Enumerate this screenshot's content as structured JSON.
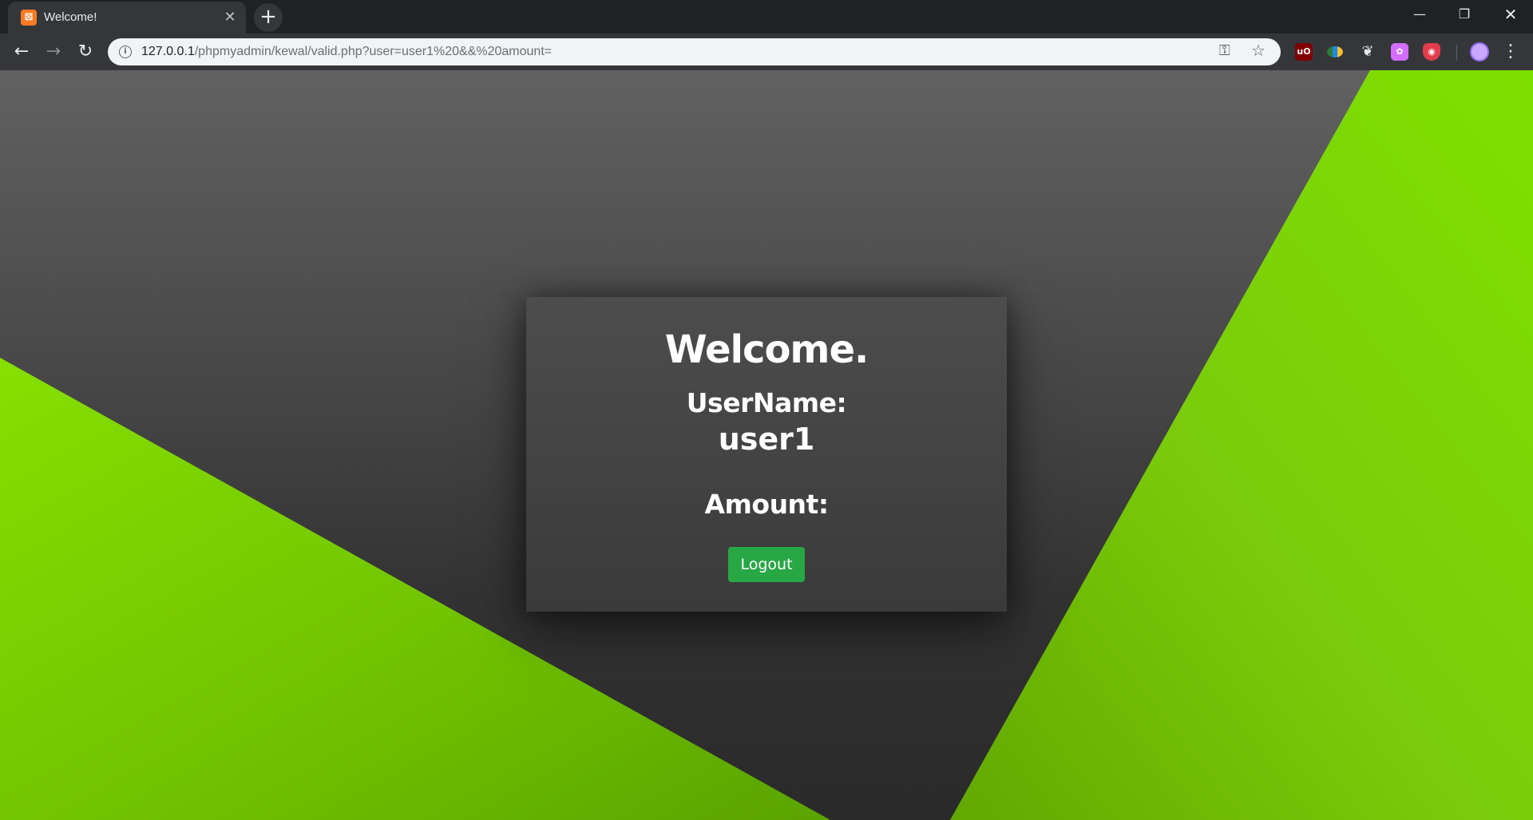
{
  "browser": {
    "tab": {
      "title": "Welcome!",
      "favicon_icon": "xampp-icon",
      "close_glyph": "✕"
    },
    "new_tab_glyph": "+",
    "window_controls": {
      "minimize": "—",
      "restore": "❐",
      "close": "✕"
    },
    "nav": {
      "back": "←",
      "forward": "→",
      "reload": "↻"
    },
    "address": {
      "host": "127.0.0.1",
      "path": "/phpmyadmin/kewal/valid.php?user=user1%20&&%20amount="
    },
    "extensions": [
      "ublock-origin-icon",
      "globe-extension-icon",
      "paw-extension-icon",
      "purple-extension-icon",
      "shield-extension-icon"
    ],
    "accent": "#35363a"
  },
  "page": {
    "heading": "Welcome.",
    "username_label": "UserName:",
    "username_value": "user1",
    "amount_label": "Amount:",
    "logout_label": "Logout",
    "colors": {
      "background_gray": "#4b4b4b",
      "background_green": "#7ed600",
      "button": "#28a745"
    }
  }
}
